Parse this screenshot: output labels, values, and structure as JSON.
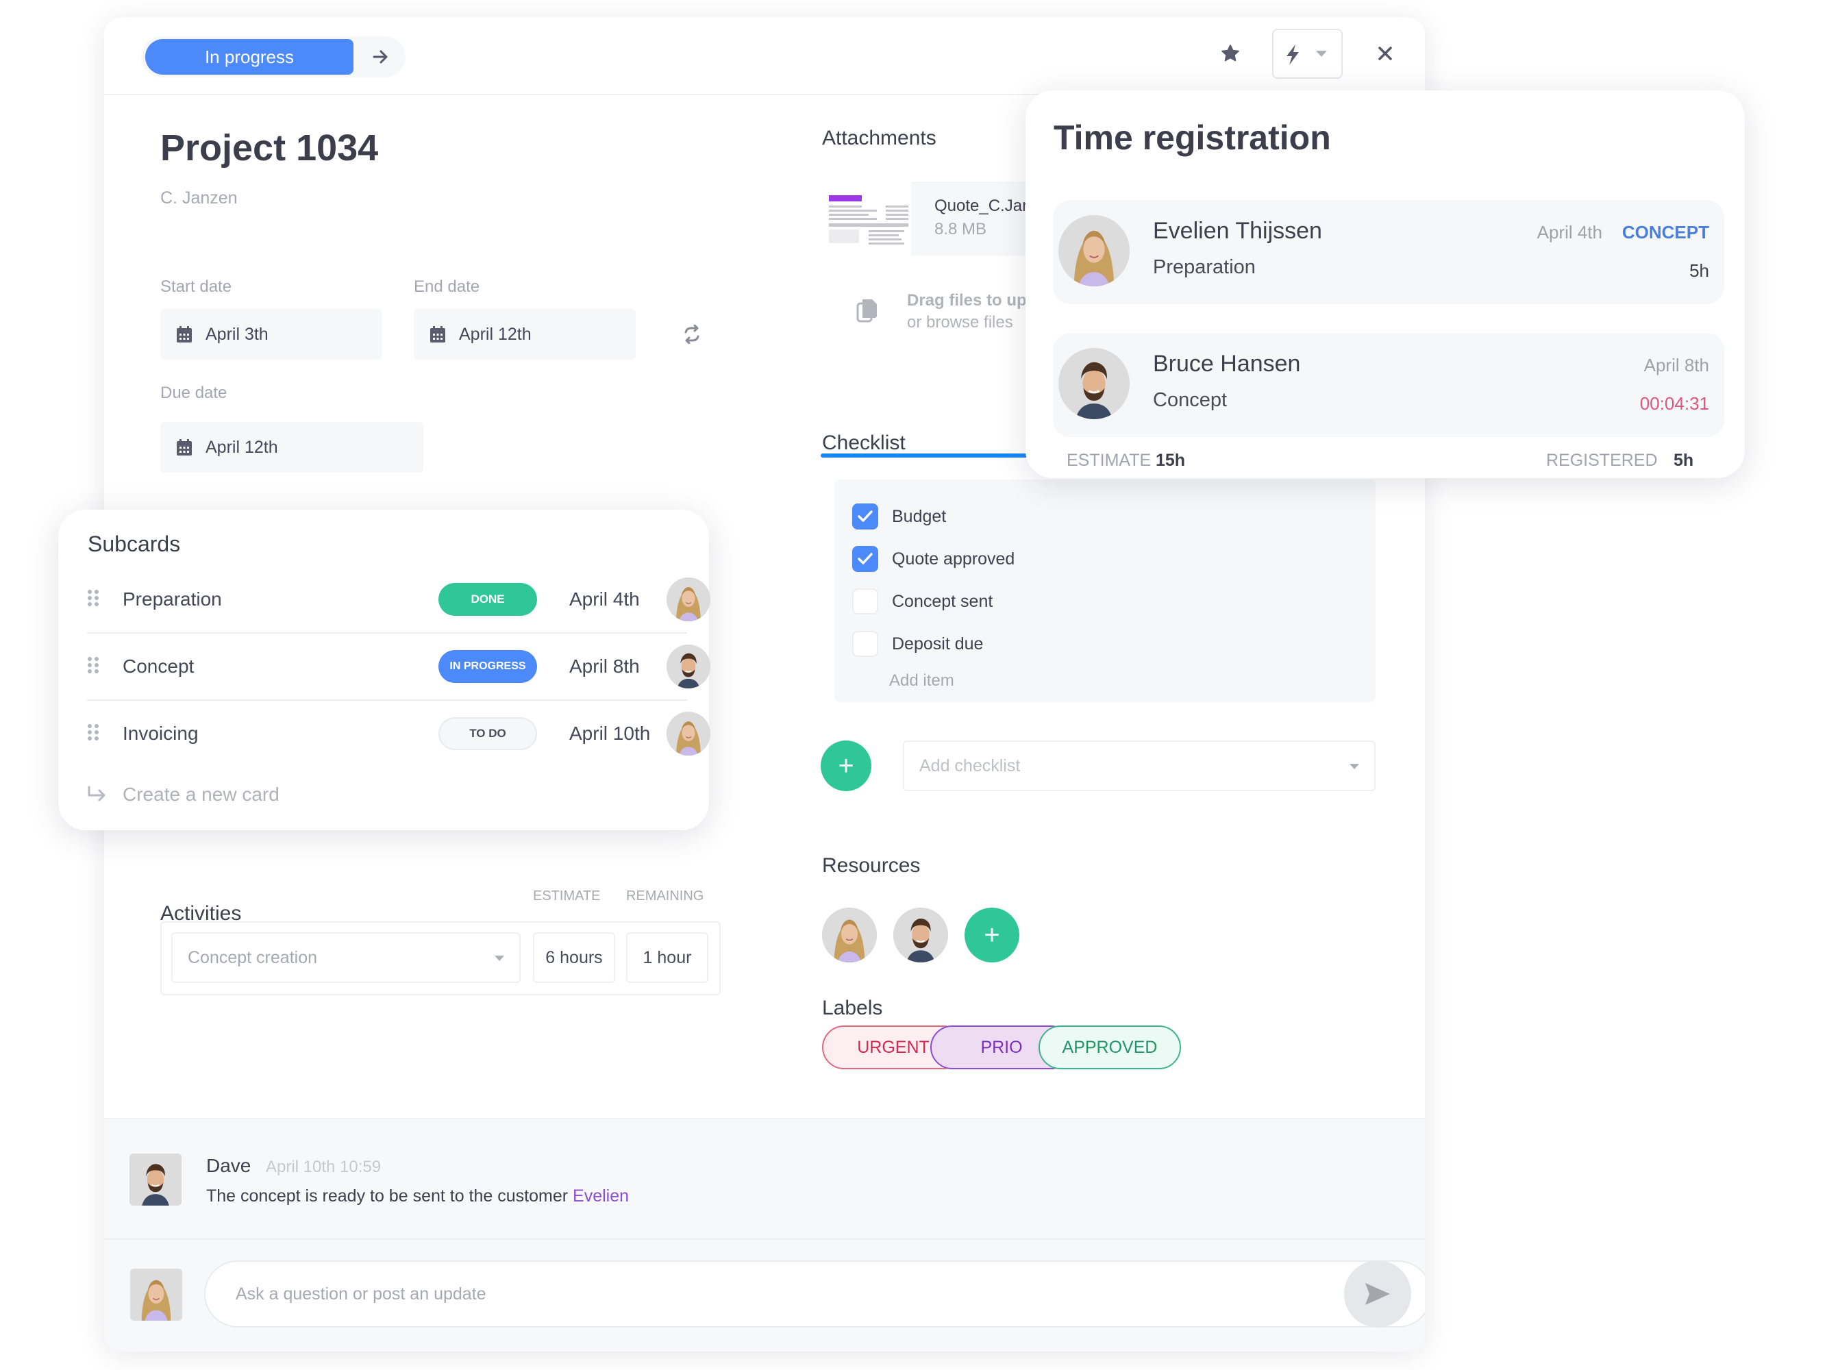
{
  "header": {
    "status_label": "In progress",
    "next_icon": "arrow-right-icon",
    "star_icon": "star-icon",
    "automation_icon": "lightning-icon",
    "close_icon": "close-icon"
  },
  "project": {
    "title": "Project 1034",
    "owner": "C. Janzen"
  },
  "dates": {
    "start_label": "Start date",
    "start_value": "April 3th",
    "end_label": "End date",
    "end_value": "April 12th",
    "due_label": "Due date",
    "due_value": "April 12th",
    "repeat_icon": "repeat-icon"
  },
  "subcards": {
    "title": "Subcards",
    "rows": [
      {
        "name": "Preparation",
        "status": "DONE",
        "date": "April 4th",
        "assignee": "Evelien Thijssen"
      },
      {
        "name": "Concept",
        "status": "IN PROGRESS",
        "date": "April 8th",
        "assignee": "Bruce Hansen"
      },
      {
        "name": "Invoicing",
        "status": "TO DO",
        "date": "April 10th",
        "assignee": "Evelien Thijssen"
      }
    ],
    "create_label": "Create a new card",
    "status_colors": {
      "DONE": "#2fc795",
      "IN PROGRESS": "#4c89f9",
      "TO DO": "#f6f7f9"
    }
  },
  "activities": {
    "title": "Activities",
    "estimate_header": "ESTIMATE",
    "remaining_header": "REMAINING",
    "activity_placeholder": "Concept creation",
    "estimate_value": "6 hours",
    "remaining_value": "1 hour"
  },
  "attachments": {
    "title": "Attachments",
    "file_name": "Quote_C.Janzen",
    "file_size": "8.8 MB",
    "drop_line1": "Drag files to upload",
    "drop_line2": "or browse files"
  },
  "checklist": {
    "title": "Checklist",
    "progress": 0.5,
    "items": [
      {
        "label": "Budget",
        "checked": true
      },
      {
        "label": "Quote approved",
        "checked": true
      },
      {
        "label": "Concept sent",
        "checked": false
      },
      {
        "label": "Deposit due",
        "checked": false
      }
    ],
    "add_item_placeholder": "Add item",
    "add_checklist_placeholder": "Add checklist"
  },
  "resources": {
    "title": "Resources",
    "people": [
      "Evelien Thijssen",
      "Bruce Hansen"
    ]
  },
  "labels": {
    "title": "Labels",
    "items": [
      {
        "text": "URGENT",
        "color": "#d8274e",
        "bg": "#fdeef1",
        "border": "#e06a80"
      },
      {
        "text": "PRIO",
        "color": "#7b2fbf",
        "bg": "#eddcf2",
        "border": "#8a4fd1"
      },
      {
        "text": "APPROVED",
        "color": "#21946a",
        "bg": "#ebfaf4",
        "border": "#3db58a"
      }
    ]
  },
  "comments": {
    "items": [
      {
        "author": "Dave",
        "timestamp": "April 10th 10:59",
        "text": "The concept is ready to be sent to the customer",
        "mention": "Evelien"
      }
    ],
    "input_placeholder": "Ask a question or post an update"
  },
  "time_registration": {
    "title": "Time registration",
    "entries": [
      {
        "name": "Evelien Thijssen",
        "task": "Preparation",
        "date": "April 4th",
        "phase": "CONCEPT",
        "duration": "5h"
      },
      {
        "name": "Bruce Hansen",
        "task": "Concept",
        "date": "April 8th",
        "timer": "00:04:31"
      }
    ],
    "estimate_label": "ESTIMATE",
    "estimate_value": "15h",
    "registered_label": "REGISTERED",
    "registered_value": "5h"
  },
  "colors": {
    "accent_blue": "#4c89f9",
    "progress_blue": "#1787f0",
    "green": "#2fc795",
    "timer_red": "#e0557a",
    "mention_purple": "#8a4fd1"
  }
}
